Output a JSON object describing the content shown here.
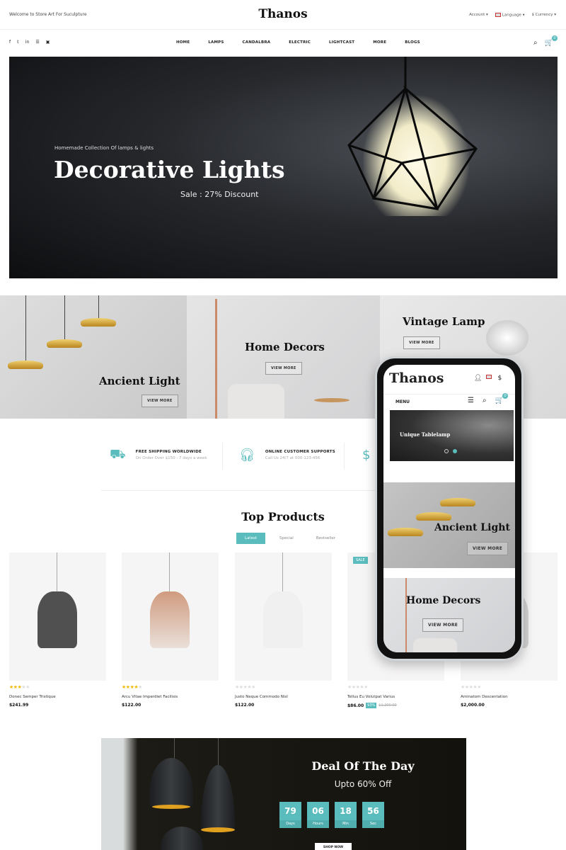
{
  "topbar": {
    "welcome": "Welcome to Store Art For Suculpture",
    "logo": "Thanos",
    "account": "Account ▾",
    "language": "Language ▾",
    "currency": "$ Currency ▾"
  },
  "nav": {
    "social": [
      "f",
      "t",
      "in",
      "rss",
      "yt"
    ],
    "items": [
      "HOME",
      "LAMPS",
      "CANDALBRA",
      "ELECTRIC",
      "LIGHTCAST",
      "MORE",
      "BLOGS"
    ],
    "cart_count": "0"
  },
  "hero": {
    "subtitle": "Homemade Collection Of lamps & lights",
    "title": "Decorative Lights",
    "sale": "Sale : 27% Discount"
  },
  "banners": [
    {
      "title": "Ancient Light",
      "button": "VIEW MORE"
    },
    {
      "title": "Home Decors",
      "button": "VIEW MORE"
    },
    {
      "title": "Vintage Lamp",
      "button": "VIEW MORE"
    }
  ],
  "features": [
    {
      "icon": "truck-icon",
      "title": "FREE SHIPPING WORLDWIDE",
      "sub": "On Order Over $150 - 7 days a week"
    },
    {
      "icon": "headset-icon",
      "title": "ONLINE CUSTOMER SUPPORTS",
      "sub": "Call Us 24/7 at 000-123-456"
    },
    {
      "icon": "money-bag-icon"
    }
  ],
  "products_section": {
    "title": "Top Products",
    "tabs": [
      "Latest",
      "Special",
      "Bestseller"
    ],
    "active_tab": "Latest"
  },
  "products": [
    {
      "name": "Donec Semper Tristique",
      "price": "$241.99",
      "rating": 3
    },
    {
      "name": "Arcu Vitae Imperdiet Facilisis",
      "price": "$122.00",
      "rating": 4
    },
    {
      "name": "Justo Neque Commodo Nisl",
      "price": "$122.00",
      "rating": 0
    },
    {
      "name": "Tellus Eu Volutpat Varius",
      "price": "$86.00",
      "discount": "93%",
      "old_price": "$1,200.00",
      "rating": 0,
      "badge": "SALE"
    },
    {
      "name": "Aminatom Descentation",
      "price": "$2,000.00",
      "rating": 0
    }
  ],
  "deal": {
    "title": "Deal Of The Day",
    "subtitle": "Upto 60% Off",
    "countdown": [
      {
        "value": "79",
        "label": "Days"
      },
      {
        "value": "06",
        "label": "Hours"
      },
      {
        "value": "18",
        "label": "Min"
      },
      {
        "value": "56",
        "label": "Sec"
      }
    ],
    "button": "SHOP NOW"
  },
  "phone": {
    "logo": "Thanos",
    "menu": "MENU",
    "cart_count": "0",
    "slider_title": "Unique Tablelamp",
    "banners": [
      {
        "title": "Ancient Light",
        "button": "VIEW MORE"
      },
      {
        "title": "Home Decors",
        "button": "VIEW MORE"
      }
    ]
  },
  "colors": {
    "accent": "#5bbcbd",
    "star": "#f2b900"
  }
}
